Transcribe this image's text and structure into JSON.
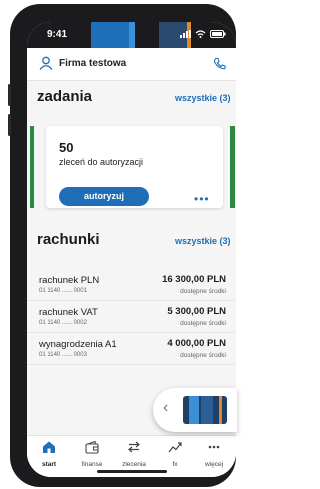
{
  "status_bar": {
    "time": "9:41"
  },
  "header": {
    "company": "Firma testowa"
  },
  "tasks": {
    "title": "zadania",
    "all_link": "wszystkie (3)",
    "card": {
      "count": "50",
      "description": "zleceń do autoryzacji",
      "button": "autoryzuj",
      "more": "•••"
    }
  },
  "accounts": {
    "title": "rachunki",
    "all_link": "wszystkie (3)",
    "items": [
      {
        "name": "rachunek PLN",
        "number": "01 1140 ...... 0001",
        "amount": "16 300,00 PLN",
        "available": "dostępne środki"
      },
      {
        "name": "rachunek VAT",
        "number": "01 1140 ...... 0002",
        "amount": "5 300,00 PLN",
        "available": "dostępne środki"
      },
      {
        "name": "wynagrodzenia A1",
        "number": "01 1140 ...... 0003",
        "amount": "4 000,00 PLN",
        "available": "dostępne środki"
      }
    ]
  },
  "floater": {
    "chevron": "‹"
  },
  "tabbar": {
    "items": [
      {
        "label": "start",
        "icon": "home-icon",
        "active": true
      },
      {
        "label": "finanse",
        "icon": "wallet-icon"
      },
      {
        "label": "zlecenia",
        "icon": "transfer-arrows-icon"
      },
      {
        "label": "fx",
        "icon": "fx-chart-icon"
      },
      {
        "label": "więcej",
        "icon": "more-dots-icon"
      }
    ]
  },
  "colors": {
    "accent": "#1e6fb8",
    "success": "#2a8a3e",
    "dark": "#1b1b1d"
  }
}
